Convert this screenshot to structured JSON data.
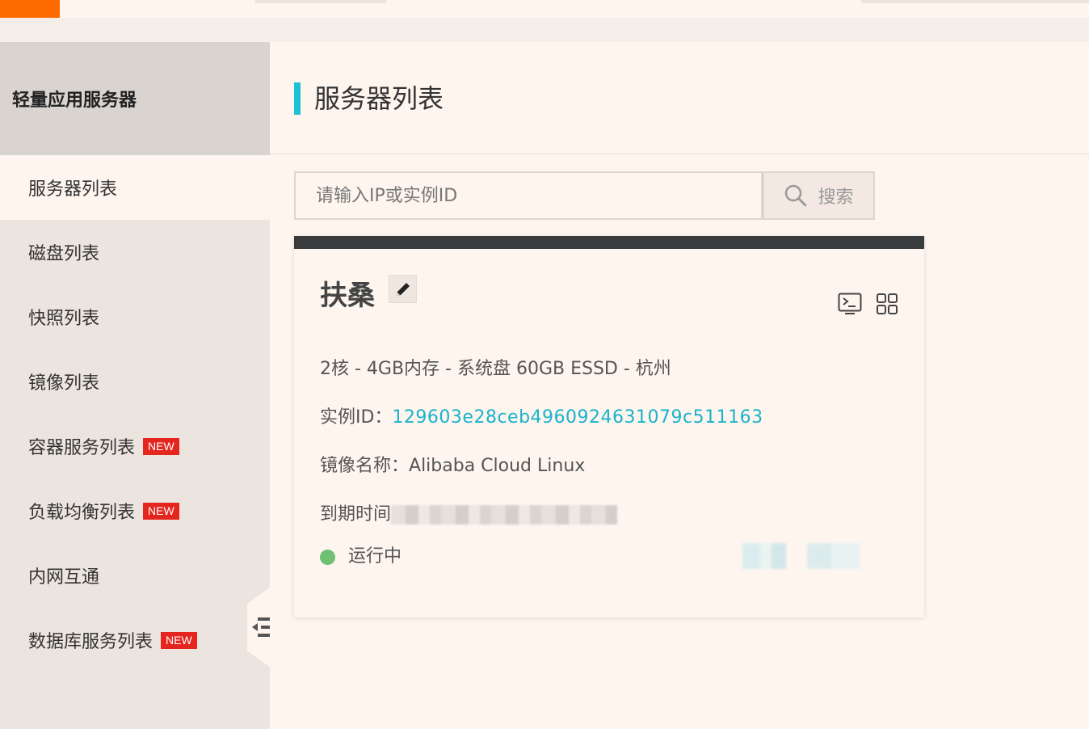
{
  "sidebar": {
    "title": "轻量应用服务器",
    "items": [
      {
        "label": "服务器列表",
        "active": true,
        "badge": ""
      },
      {
        "label": "磁盘列表",
        "badge": ""
      },
      {
        "label": "快照列表",
        "badge": ""
      },
      {
        "label": "镜像列表",
        "badge": ""
      },
      {
        "label": "容器服务列表",
        "badge": "NEW"
      },
      {
        "label": "负载均衡列表",
        "badge": "NEW"
      },
      {
        "label": "内网互通",
        "badge": ""
      },
      {
        "label": "数据库服务列表",
        "badge": "NEW"
      }
    ]
  },
  "header": {
    "title": "服务器列表"
  },
  "search": {
    "placeholder": "请输入IP或实例ID",
    "button_label": "搜索"
  },
  "card": {
    "name": "扶桑",
    "spec": "2核 - 4GB内存 - 系统盘 60GB ESSD - 杭州",
    "instance_label": "实例ID：",
    "instance_id": "129603e28ceb4960924631079c511163",
    "image_label": "镜像名称：",
    "image_name": "Alibaba Cloud Linux",
    "expire_label": "到期时间",
    "status": "运行中",
    "status_color": "#6ec074"
  },
  "colors": {
    "brand": "#ff6a00",
    "accent": "#1ec0d6",
    "link": "#1ab3cc",
    "badge": "#e5261f"
  }
}
